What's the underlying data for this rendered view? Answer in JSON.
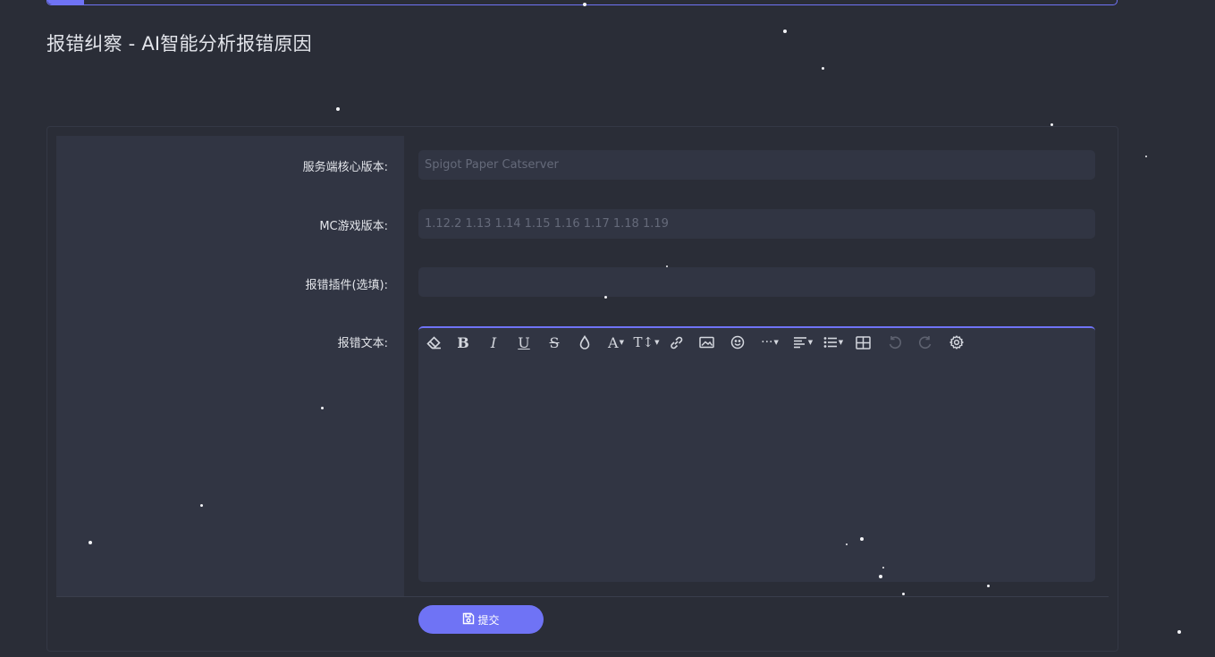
{
  "page": {
    "title": "报错纠察 - AI智能分析报错原因"
  },
  "form": {
    "core_version": {
      "label": "服务端核心版本:",
      "placeholder": "Spigot Paper Catserver",
      "value": ""
    },
    "mc_version": {
      "label": "MC游戏版本:",
      "placeholder": "1.12.2 1.13 1.14 1.15 1.16 1.17 1.18 1.19",
      "value": ""
    },
    "plugin": {
      "label": "报错插件(选填):",
      "placeholder": "",
      "value": ""
    },
    "error_text": {
      "label": "报错文本:",
      "value": ""
    },
    "submit_label": "提交"
  },
  "editor_toolbar": [
    "eraser-icon",
    "bold-icon",
    "italic-icon",
    "underline-icon",
    "strikethrough-icon",
    "color-drop-icon",
    "font-color-icon",
    "font-size-icon",
    "link-icon",
    "image-icon",
    "emoji-icon",
    "more-icon",
    "align-icon",
    "list-icon",
    "table-icon",
    "undo-icon",
    "redo-icon",
    "settings-icon"
  ],
  "colors": {
    "accent": "#6f73f5",
    "background": "#2a2d37",
    "panel": "#313543"
  }
}
